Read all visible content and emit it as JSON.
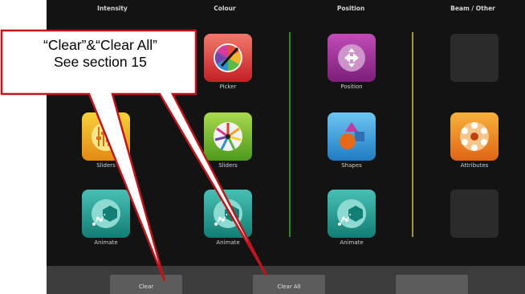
{
  "columns": [
    "Intensity",
    "Colour",
    "Position",
    "Beam / Other"
  ],
  "tiles": {
    "intensity_sliders": "Sliders",
    "intensity_animate": "Animate",
    "colour_picker": "Picker",
    "colour_sliders": "Sliders",
    "colour_animate": "Animate",
    "position_position": "Position",
    "position_shapes": "Shapes",
    "position_animate": "Animate",
    "beam_attributes": "Attributes"
  },
  "footer": {
    "clear_label": "Clear",
    "clear_all_label": "Clear All",
    "blank_label": ""
  },
  "callout": {
    "line1": "“Clear”&“Clear All”",
    "line2": "See section 15"
  },
  "colors": {
    "background": "#131313",
    "divider_green": "#2f8a25",
    "divider_yellow": "#a49a1e",
    "callout_border": "#c0141c",
    "footer": "#3c3c3c"
  },
  "icons": [
    "color-wheel-icon",
    "position-arrows-icon",
    "faders-icon",
    "rainbow-wheel-icon",
    "shapes-icon",
    "animate-icon",
    "attributes-icon"
  ]
}
